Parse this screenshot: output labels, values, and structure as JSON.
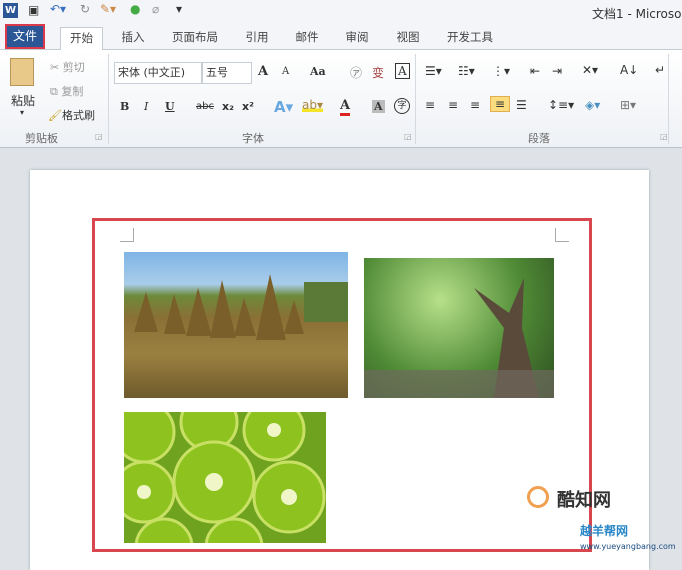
{
  "titlebar": {
    "title": "文档1 - Microso",
    "icons": [
      "word-logo-icon",
      "save-icon",
      "undo-icon",
      "redo-icon",
      "paint-icon",
      "color-icon",
      "eraser-icon",
      "customize-icon"
    ]
  },
  "tabs": {
    "file": "文件",
    "items": [
      "开始",
      "插入",
      "页面布局",
      "引用",
      "邮件",
      "审阅",
      "视图",
      "开发工具"
    ],
    "active": "开始"
  },
  "ribbon": {
    "clipboard": {
      "label": "剪贴板",
      "paste": "粘贴",
      "cut": "剪切",
      "copy": "复制",
      "format_painter": "格式刷"
    },
    "font": {
      "label": "字体",
      "font_name": "宋体 (中文正)",
      "font_size": "五号",
      "bold": "B",
      "italic": "I",
      "underline": "U",
      "strike": "abc",
      "subscript": "x₂",
      "superscript": "x²",
      "grow": "A",
      "shrink": "A",
      "case": "Aa",
      "font_color": "A",
      "char_shade": "A",
      "enclose": "字"
    },
    "paragraph": {
      "label": "段落"
    }
  },
  "document": {
    "images": [
      "straw-field-photo",
      "tree-photo",
      "kiwi-photo"
    ]
  },
  "watermark": {
    "brand1": "酷知网",
    "brand2": "越羊帮网",
    "url": "www.yueyangbang.com"
  },
  "colors": {
    "file_tab": "#2b5797",
    "highlight": "#d9474e"
  }
}
